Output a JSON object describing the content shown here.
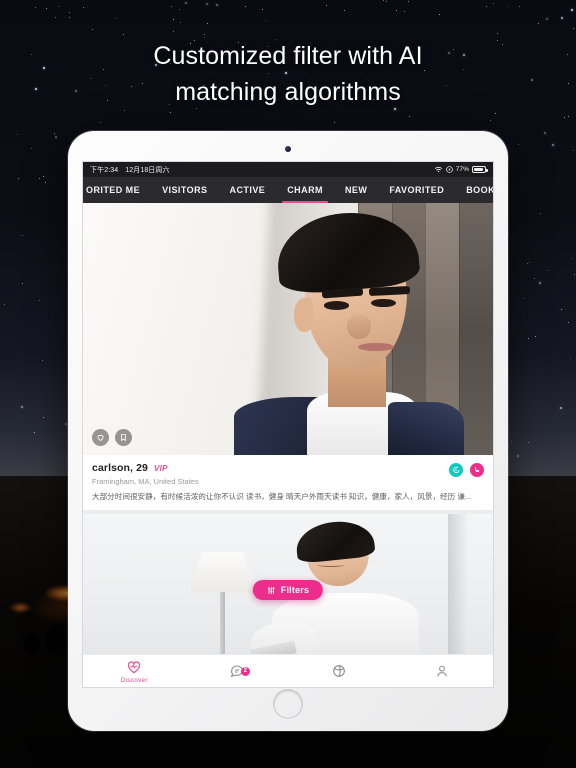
{
  "headline": {
    "line1": "Customized filter with AI",
    "line2": "matching algorithms"
  },
  "status_bar": {
    "time": "下午2:34",
    "date": "12月18日周六",
    "wifi_icon": "wifi-icon",
    "location_icon": "location-icon",
    "battery_percent": "77%"
  },
  "tabs": [
    {
      "label": "ORITED ME",
      "active": false
    },
    {
      "label": "VISITORS",
      "active": false
    },
    {
      "label": "ACTIVE",
      "active": false
    },
    {
      "label": "CHARM",
      "active": true
    },
    {
      "label": "NEW",
      "active": false
    },
    {
      "label": "FAVORITED",
      "active": false
    },
    {
      "label": "BOOKMARK",
      "active": false
    }
  ],
  "cards": [
    {
      "name": "carlson, 29",
      "vip_badge": "VIP",
      "location": "Framingham, MA, United States",
      "bio": "大部分时间很安静，有时候活泼的让你不认识 读书，健身 晴天户外雨天读书 知识，健康，家人，风景，经历 谦...",
      "like_icon": "heart-icon",
      "bookmark_icon": "bookmark-icon",
      "message_icon": "chat-icon",
      "call_icon": "phone-icon"
    }
  ],
  "filters_button": {
    "label": "Filters",
    "icon": "sliders-icon"
  },
  "bottom_nav": [
    {
      "label": "Discover",
      "icon": "heart-pulse-icon",
      "active": true,
      "badge": ""
    },
    {
      "label": "",
      "icon": "chat-bubble-icon",
      "active": false,
      "badge": "2"
    },
    {
      "label": "",
      "icon": "globe-icon",
      "active": false,
      "badge": ""
    },
    {
      "label": "",
      "icon": "person-icon",
      "active": false,
      "badge": ""
    }
  ],
  "colors": {
    "accent_pink": "#ec2d8c",
    "tab_pink": "#ec4a93",
    "teal": "#12c7bd",
    "tabbar_bg": "#2b2b2d",
    "statusbar_bg": "#1c1c1e"
  }
}
